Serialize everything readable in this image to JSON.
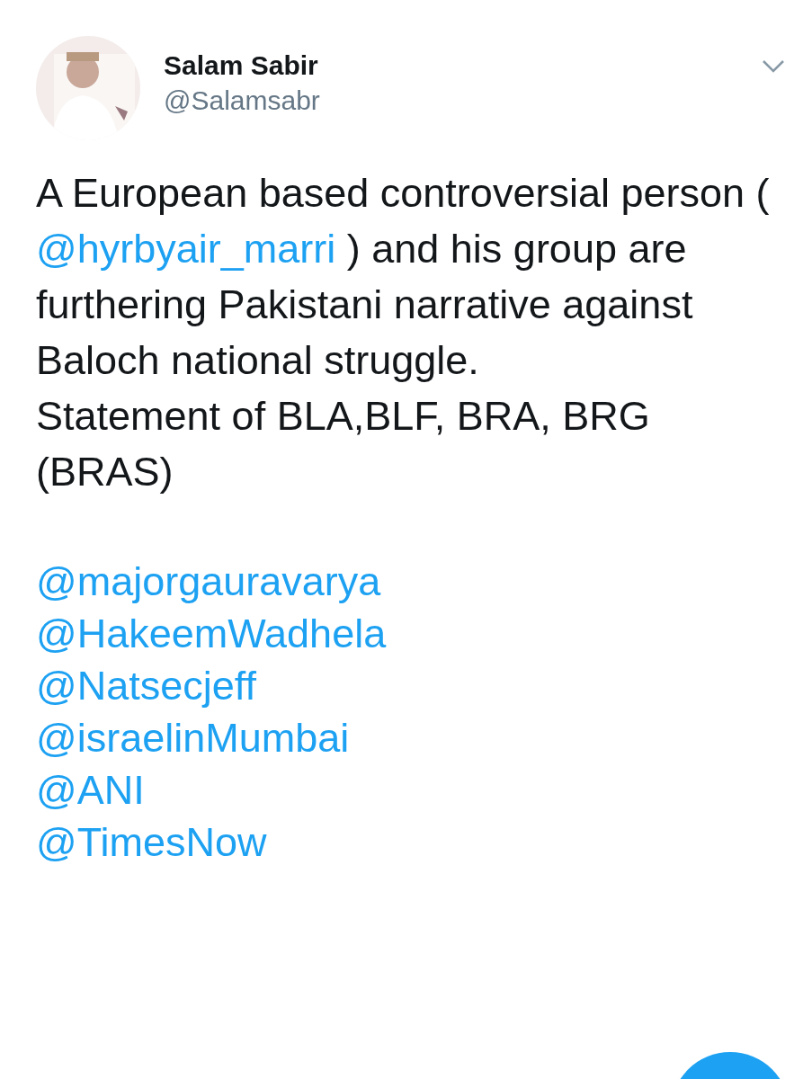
{
  "author": {
    "name": "Salam Sabir",
    "handle": "@Salamsabr"
  },
  "body": [
    {
      "kind": "text",
      "text": "A European based controversial person ( "
    },
    {
      "kind": "mention",
      "text": "@hyrbyair_marri"
    },
    {
      "kind": "text",
      "text": " ) and his group are furthering Pakistani narrative against Baloch national struggle.\nStatement of BLA,BLF, BRA, BRG (BRAS)"
    }
  ],
  "mentions": [
    "@majorgauravarya",
    "@HakeemWadhela",
    "@Natsecjeff",
    "@israelinMumbai",
    "@ANI",
    "@TimesNow"
  ]
}
